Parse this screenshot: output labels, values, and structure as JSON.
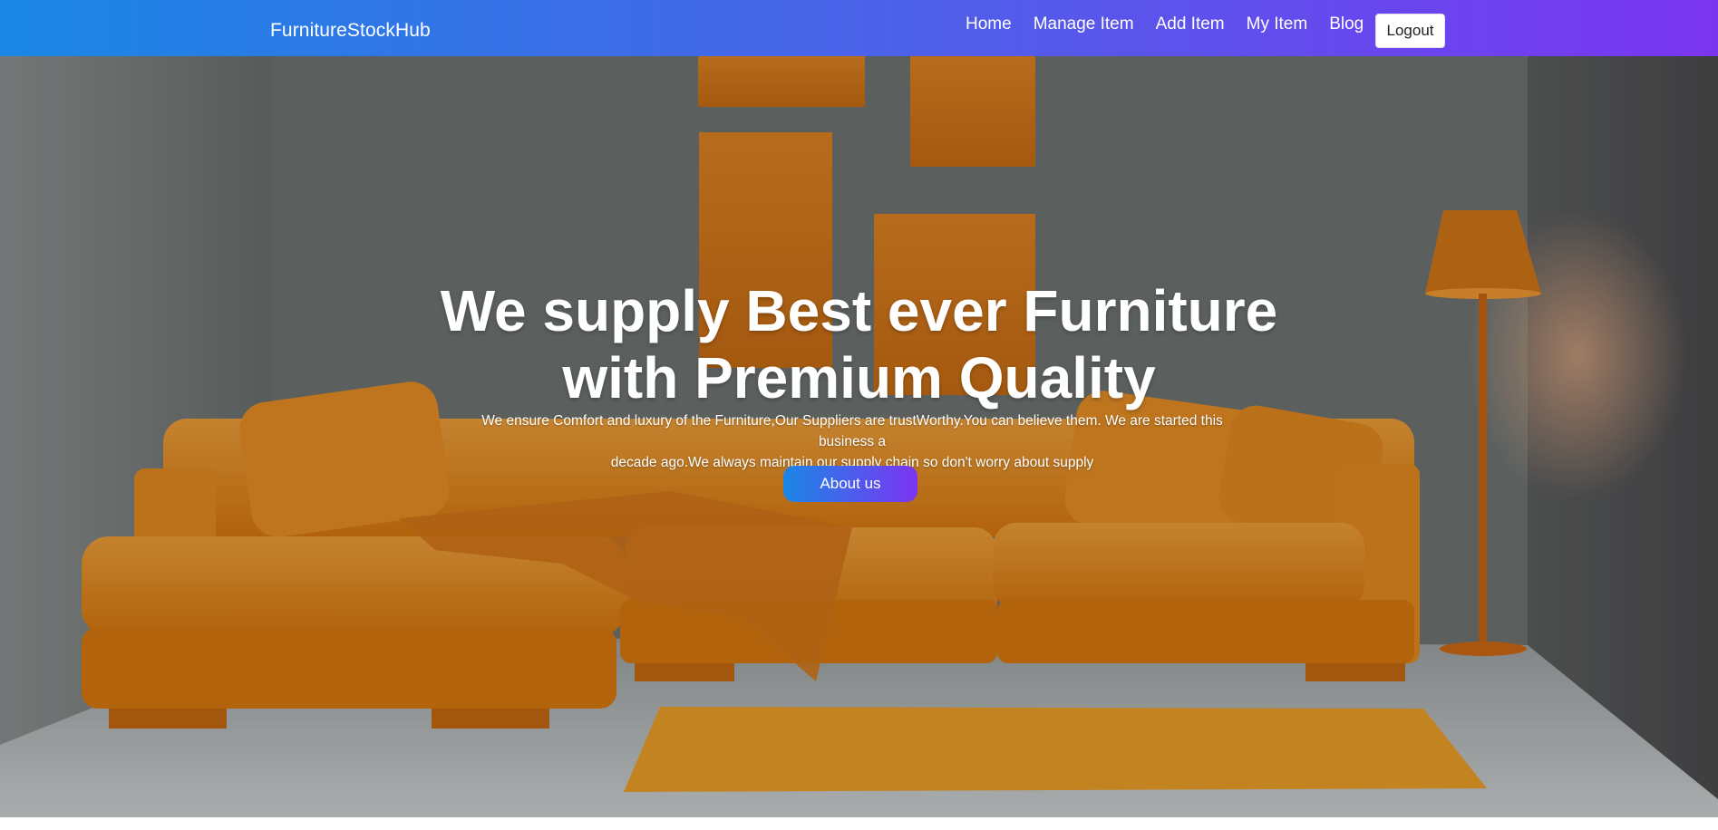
{
  "navbar": {
    "brand": "FurnitureStockHub",
    "links": [
      "Home",
      "Manage Item",
      "Add Item",
      "My Item",
      "Blog"
    ],
    "logout_label": "Logout"
  },
  "hero": {
    "title_line1": "We supply Best ever Furniture",
    "title_line2": "with Premium Quality",
    "text_line1": "We ensure Comfort and luxury of the Furniture,Our Suppliers are trustWorthy.You can believe them. We are started this business a",
    "text_line2": "decade ago.We always maintain our supply chain so don't worry about supply",
    "button_label": "About us"
  },
  "colors": {
    "nav_gradient_start": "#1a87e6",
    "nav_gradient_end": "#7b35f2",
    "sofa_orange": "#e88a1a",
    "wall_gray": "#6e7473"
  }
}
